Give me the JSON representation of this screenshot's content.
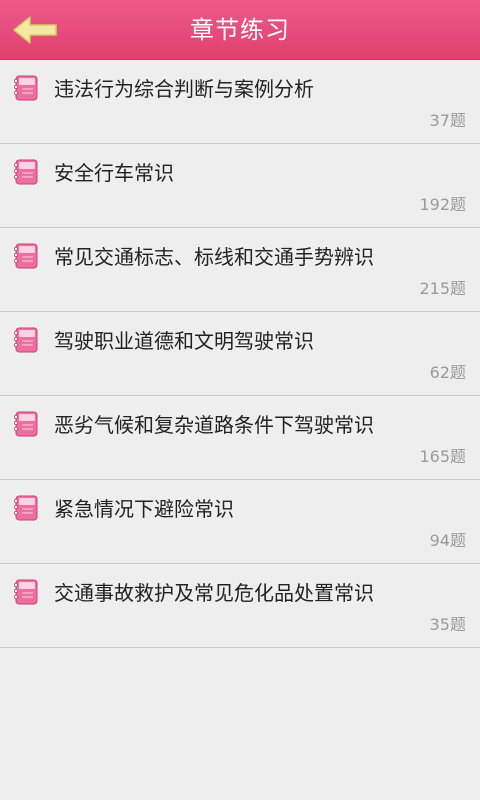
{
  "header": {
    "title": "章节练习",
    "accent_color": "#e44a78",
    "back_icon": "back-arrow-icon"
  },
  "chapters": [
    {
      "title": "违法行为综合判断与案例分析",
      "count": "37题"
    },
    {
      "title": "安全行车常识",
      "count": "192题"
    },
    {
      "title": "常见交通标志、标线和交通手势辨识",
      "count": "215题"
    },
    {
      "title": "驾驶职业道德和文明驾驶常识",
      "count": "62题"
    },
    {
      "title": "恶劣气候和复杂道路条件下驾驶常识",
      "count": "165题"
    },
    {
      "title": "紧急情况下避险常识",
      "count": "94题"
    },
    {
      "title": "交通事故救护及常见危化品处置常识",
      "count": "35题"
    }
  ],
  "chapter_icon": "notebook-icon"
}
